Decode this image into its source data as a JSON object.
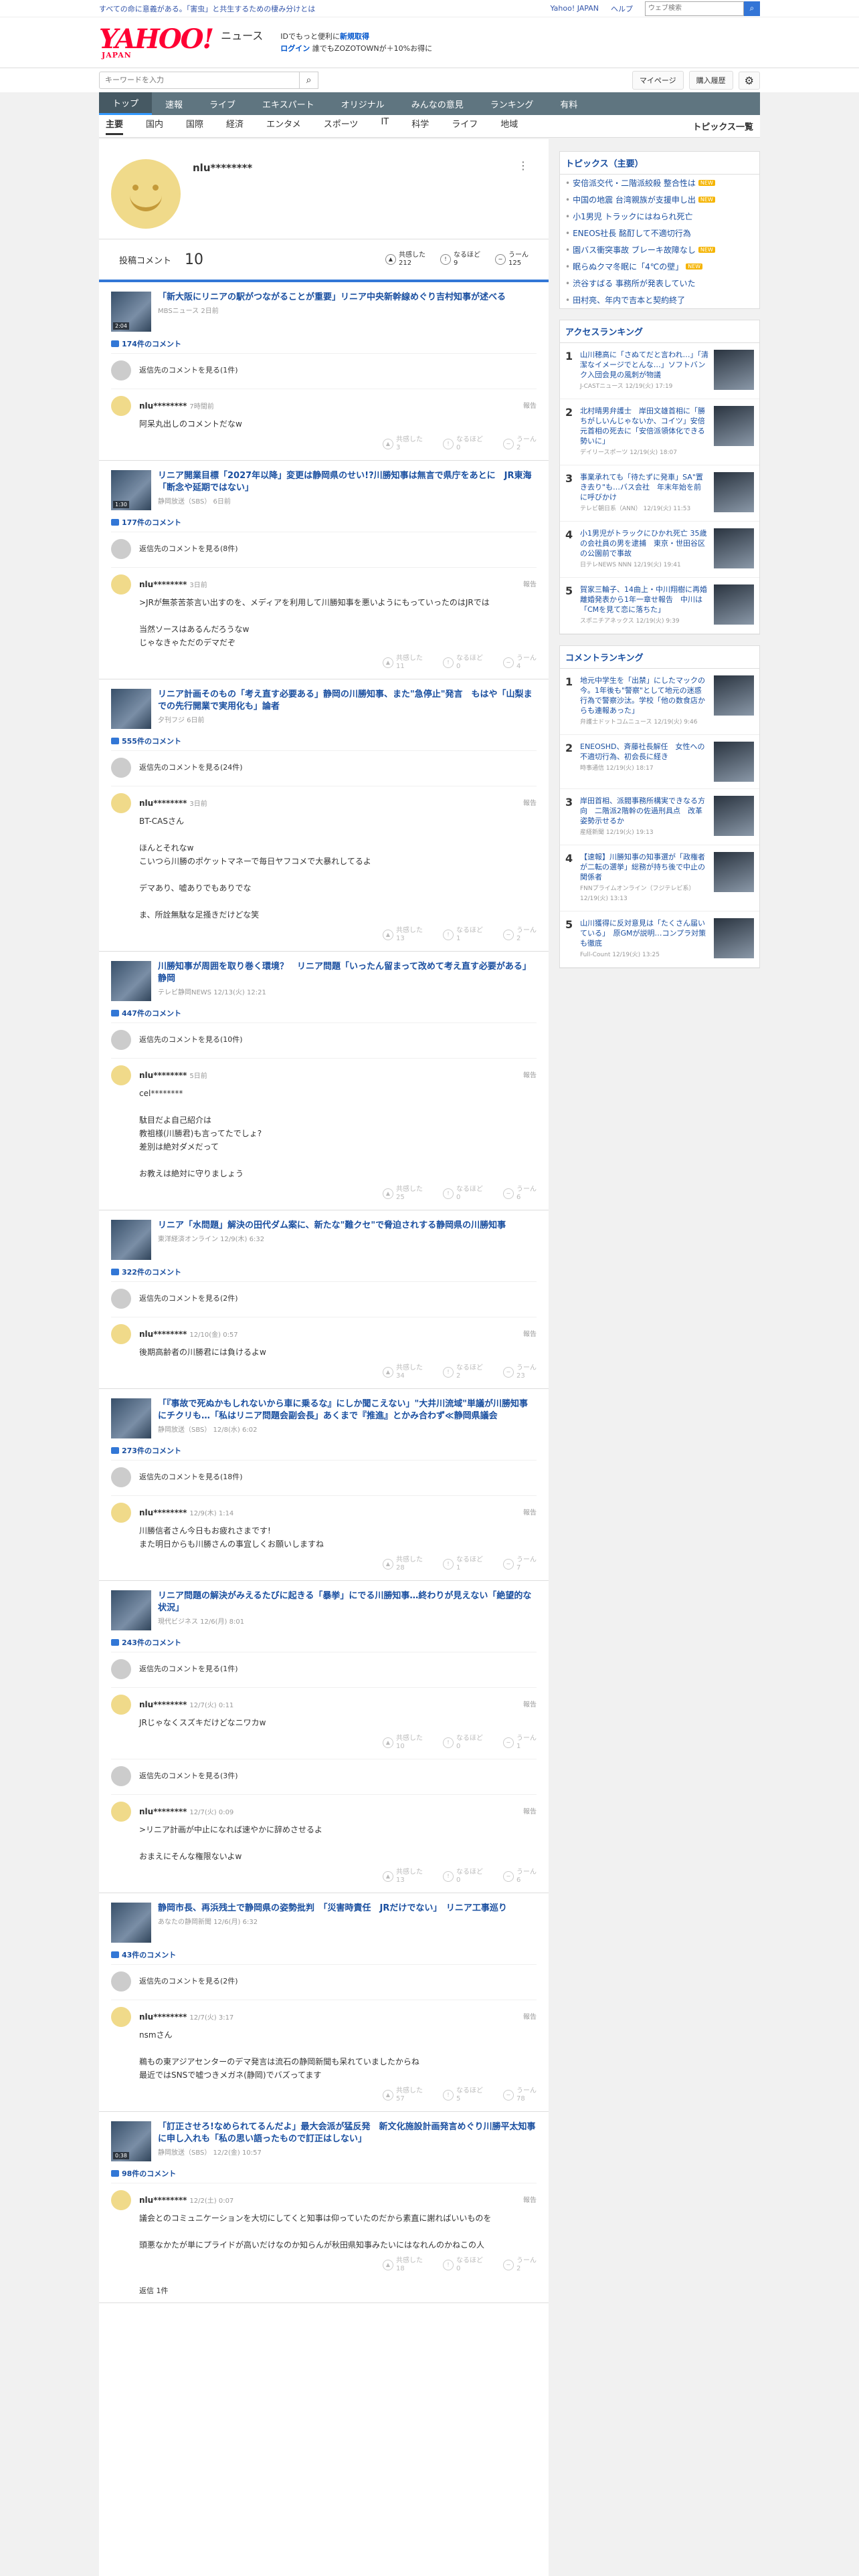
{
  "topbar": {
    "notice": "すべての命に意義がある。「害虫」と共生するための棲み分けとは",
    "links": [
      "Yahoo! JAPAN",
      "ヘルプ"
    ],
    "search_placeholder": "ウェブ検索"
  },
  "brand": {
    "logo": "YAHOO!",
    "logo_sub": "JAPAN",
    "service": "ニュース",
    "promo1_a": "IDでもっと便利に",
    "promo1_b": "新規取得",
    "promo2_a": "ログイン",
    "promo2_b": "誰でもZOZOTOWNが＋10%お得に"
  },
  "tools": {
    "keyword_placeholder": "キーワードを入力",
    "mypage": "マイページ",
    "buy": "購入履歴"
  },
  "nav": [
    "トップ",
    "速報",
    "ライブ",
    "エキスパート",
    "オリジナル",
    "みんなの意見",
    "ランキング",
    "有料"
  ],
  "subnav": {
    "cats": [
      "主要",
      "国内",
      "国際",
      "経済",
      "エンタメ",
      "スポーツ",
      "IT",
      "科学",
      "ライフ",
      "地域"
    ],
    "all": "トピックス一覧"
  },
  "profile": {
    "name": "nlu********",
    "count_label": "投稿コメント",
    "count": "10",
    "reactions": [
      {
        "label": "共感した",
        "value": "212"
      },
      {
        "label": "なるほど",
        "value": "9"
      },
      {
        "label": "うーん",
        "value": "125"
      }
    ]
  },
  "articles": [
    {
      "title": "「新大阪にリニアの駅がつながることが重要」リニア中央新幹線めぐり吉村知事が述べる",
      "source": "MBSニュース 2日前",
      "play": "2:04",
      "count": "174件のコメント",
      "comments": [
        {
          "parent": "返信先のコメントを見る(1件)",
          "user": "nlu********",
          "time": "7時間前",
          "text": "阿呆丸出しのコメントだなw",
          "r": [
            "3",
            "0",
            "2"
          ]
        }
      ]
    },
    {
      "title": "リニア開業目標「2027年以降」変更は静岡県のせい!?川勝知事は無言で県庁をあとに　JR東海「断念や延期ではない」",
      "source": "静岡放送（SBS） 6日前",
      "play": "1:30",
      "count": "177件のコメント",
      "comments": [
        {
          "parent": "返信先のコメントを見る(8件)",
          "user": "nlu********",
          "time": "3日前",
          "text": ">JRが無茶苦茶言い出すのを、メディアを利用して川勝知事を悪いようにもっていったのはJRでは\n\n当然ソースはあるんだろうなw\nじゃなきゃただのデマだぞ",
          "r": [
            "11",
            "0",
            "4"
          ]
        }
      ]
    },
    {
      "title": "リニア計画そのもの「考え直す必要ある」静岡の川勝知事、また\"急停止\"発言　もはや「山梨までの先行開業で実用化も」論者",
      "source": "夕刊フジ 6日前",
      "play": "",
      "count": "555件のコメント",
      "comments": [
        {
          "parent": "返信先のコメントを見る(24件)",
          "user": "nlu********",
          "time": "3日前",
          "text": "BT-CASさん\n\nほんとそれなw\nこいつら川勝のポケットマネーで毎日ヤフコメで大暴れしてるよ\n\nデマあり、嘘ありでもありでな\n\nま、所詮無駄な足掻きだけどな笑",
          "r": [
            "13",
            "1",
            "2"
          ]
        }
      ]
    },
    {
      "title": "川勝知事が周囲を取り巻く環境？　リニア問題「いったん留まって改めて考え直す必要がある」　静岡",
      "source": "テレビ静岡NEWS 12/13(火) 12:21",
      "play": "",
      "count": "447件のコメント",
      "comments": [
        {
          "parent": "返信先のコメントを見る(10件)",
          "user": "nlu********",
          "time": "5日前",
          "text": "cel********\n\n駄目だよ自己紹介は\n教祖様(川勝君)も言ってたでしょ?\n差別は絶対ダメだって\n\nお教えは絶対に守りましょう",
          "r": [
            "25",
            "0",
            "6"
          ]
        }
      ]
    },
    {
      "title": "リニア「水問題」解決の田代ダム案に、新たな\"難クセ\"で脅迫されする静岡県の川勝知事",
      "source": "東洋経済オンライン 12/9(木) 6:32",
      "play": "",
      "count": "322件のコメント",
      "comments": [
        {
          "parent": "返信先のコメントを見る(2件)",
          "user": "nlu********",
          "time": "12/10(金) 0:57",
          "text": "後期高齢者の川勝君には負けるよw",
          "r": [
            "34",
            "2",
            "23"
          ]
        }
      ]
    },
    {
      "title": "「『事故で死ぬかもしれないから車に乗るな』にしか聞こえない」\"大井川流域\"単議が川勝知事にチクリも…「私はリニア問題会副会長」あくまで『推進』とかみ合わず≪静岡県議会",
      "source": "静岡放送（SBS） 12/8(水) 6:02",
      "play": "",
      "count": "273件のコメント",
      "comments": [
        {
          "parent": "返信先のコメントを見る(18件)",
          "user": "nlu********",
          "time": "12/9(木) 1:14",
          "text": "川勝信者さん今日もお疲れさまです!\nまた明日からも川勝さんの事宜しくお願いしますね",
          "r": [
            "28",
            "1",
            "7"
          ]
        }
      ]
    },
    {
      "title": "リニア問題の解決がみえるたびに起きる「暴挙」にでる川勝知事…終わりが見えない「絶望的な状況」",
      "source": "現代ビジネス 12/6(月) 8:01",
      "play": "",
      "count": "243件のコメント",
      "comments": [
        {
          "parent": "返信先のコメントを見る(1件)",
          "user": "nlu********",
          "time": "12/7(火) 0:11",
          "text": "JRじゃなくスズキだけどなニワカw",
          "r": [
            "10",
            "0",
            "1"
          ]
        },
        {
          "parent": "返信先のコメントを見る(3件)",
          "user": "nlu********",
          "time": "12/7(火) 0:09",
          "text": ">リニア計画が中止になれば速やかに辞めさせるよ\n\nおまえにそんな権限ないよw",
          "r": [
            "13",
            "0",
            "6"
          ]
        }
      ]
    },
    {
      "title": "静岡市長、再浜残土で静岡県の姿勢批判　「災害時責任　JRだけでない」　リニア工事巡り",
      "source": "あなたの静岡新聞 12/6(月) 6:32",
      "play": "",
      "count": "43件のコメント",
      "comments": [
        {
          "parent": "返信先のコメントを見る(2件)",
          "user": "nlu********",
          "time": "12/7(火) 3:17",
          "text": "nsmさん\n\n鵜もの東アジアセンターのデマ発言は流石の静岡新聞も呆れていましたからね\n最近ではSNSで嘘つきメガネ(静岡)でバズってます",
          "r": [
            "57",
            "5",
            "78"
          ]
        }
      ]
    },
    {
      "title": "「訂正させろ!なめられてるんだよ」最大会派が猛反発　新文化施設計画発言めぐり川勝平太知事に申し入れも「私の思い語ったもので訂正はしない」",
      "source": "静岡放送（SBS） 12/2(金) 10:57",
      "play": "0:38",
      "count": "98件のコメント",
      "comments": [
        {
          "parent": "",
          "user": "nlu********",
          "time": "12/2(土) 0:07",
          "text": "議会とのコミュニケーションを大切にしてくと知事は仰っていたのだから素直に謝ればいいものを\n\n頭悪なかたが単にプライドが高いだけなのか知らんが秋田県知事みたいにはなれんのかねこの人",
          "r": [
            "18",
            "0",
            "2"
          ]
        }
      ]
    }
  ],
  "reply_footer": "返信 1件",
  "sidebar": {
    "topics_title": "トピックス（主要）",
    "topics": [
      {
        "t": "安倍派交代・二階派絞殺 整合性は",
        "new": "NEW"
      },
      {
        "t": "中国の地震 台湾親族が支援申し出",
        "new": "NEW"
      },
      {
        "t": "小1男児 トラックにはねられ死亡",
        "new": ""
      },
      {
        "t": "ENEOS社長 酩酊して不適切行為",
        "new": ""
      },
      {
        "t": "園バス衝突事故 ブレーキ故障なし",
        "new": "NEW"
      },
      {
        "t": "眠らぬクマ冬眠に「4℃の壁」",
        "new": "NEW"
      },
      {
        "t": "渋谷すばる 事務所が発表していた",
        "new": ""
      },
      {
        "t": "田村亮、年内で吉本と契約終了",
        "new": ""
      }
    ],
    "access_title": "アクセスランキング",
    "access": [
      {
        "t": "山川穂高に「さぬてだと言われ…」「清潔なイメージでとんな…」ソフトバンク入団会見の風刺が物議",
        "s": "J-CASTニュース 12/19(火) 17:19"
      },
      {
        "t": "北村晴男弁護士　岸田文雄首相に「勝ちがしいんじゃないか、コイツ」安倍元首相の死去に「安倍派領体化できる勢いに」",
        "s": "デイリースポーツ 12/19(火) 18:07"
      },
      {
        "t": "事業承れても「待たずに発車」SA\"置き去り\"も…バス会社　年末年始を前に呼びかけ",
        "s": "テレビ朝日系（ANN） 12/19(火) 11:53"
      },
      {
        "t": "小1男児がトラックにひかれ死亡 35歳の会社員の男を逮捕　東京・世田谷区の公園前で事故",
        "s": "日テレNEWS NNN 12/19(火) 19:41"
      },
      {
        "t": "賀家三輪子、14曲上・中川翔樹に再婚　離婚発表から1年一章せ報告　中川は「CMを見て恋に落ちた」",
        "s": "スポニチアネックス 12/19(火) 9:39"
      }
    ],
    "comment_title": "コメントランキング",
    "commentrank": [
      {
        "t": "地元中学生を「出禁」にしたマックの今。1年後も\"警察\"として地元の迷惑行為で警察沙汰。学校「他の数食店からも連報あった」",
        "s": "弁護士ドットコムニュース 12/19(火) 9:46"
      },
      {
        "t": "ENEOSHD、斉藤社長解任　女性への不適切行為、初会長に経き",
        "s": "時事通信 12/19(火) 18:17"
      },
      {
        "t": "岸田首相、派閥事務所構実できなる方向　二階派2階幹の佐過刑具点　改革姿勢示せるか",
        "s": "産経新聞 12/19(火) 19:13"
      },
      {
        "t": "【速報】川勝知事の知事選が「政権者が二転の選挙」総務が持ち後で中止の関係者",
        "s": "FNNプライムオンライン（フジテレビ系） 12/19(火) 13:13"
      },
      {
        "t": "山川獲得に反対意見は「たくさん届いている」　原GMが説明…コンプラ対策も徹底",
        "s": "Full-Count 12/19(火) 13:25"
      }
    ]
  }
}
